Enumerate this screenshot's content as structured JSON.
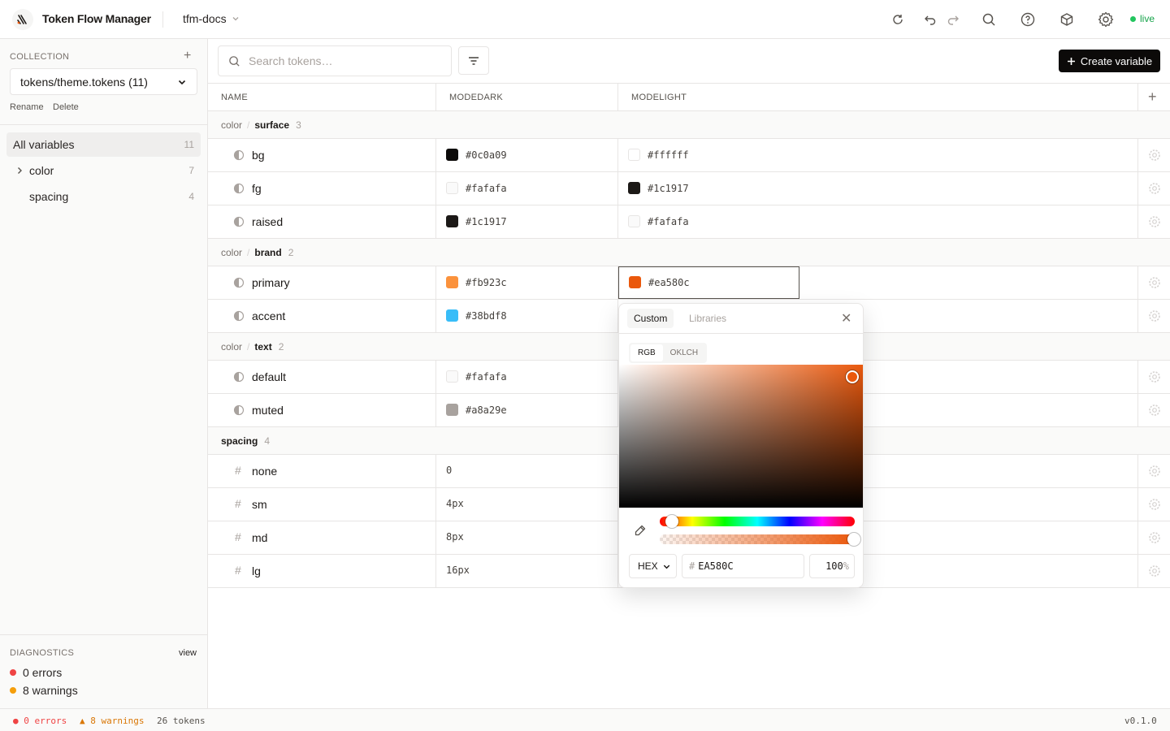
{
  "app": {
    "title": "Token Flow Manager",
    "project": "tfm-docs",
    "status": "live"
  },
  "sidebar": {
    "collection_label": "COLLECTION",
    "collection_value": "tokens/theme.tokens (11)",
    "rename": "Rename",
    "delete": "Delete",
    "nav": [
      {
        "label": "All variables",
        "count": "11"
      },
      {
        "label": "color",
        "count": "7"
      },
      {
        "label": "spacing",
        "count": "4"
      }
    ],
    "diagnostics": {
      "label": "DIAGNOSTICS",
      "view": "view",
      "errors": "0 errors",
      "warnings": "8 warnings"
    }
  },
  "toolbar": {
    "search_placeholder": "Search tokens…",
    "create": "Create variable"
  },
  "table": {
    "headers": [
      "NAME",
      "MODEDARK",
      "MODELIGHT"
    ],
    "groups": [
      {
        "prefix": "color",
        "name": "surface",
        "count": "3"
      },
      {
        "prefix": "color",
        "name": "brand",
        "count": "2"
      },
      {
        "prefix": "color",
        "name": "text",
        "count": "2"
      },
      {
        "prefix": "",
        "name": "spacing",
        "count": "4"
      }
    ],
    "rows": [
      {
        "name": "bg",
        "dark": "#0c0a09",
        "light": "#ffffff"
      },
      {
        "name": "fg",
        "dark": "#fafafa",
        "light": "#1c1917"
      },
      {
        "name": "raised",
        "dark": "#1c1917",
        "light": "#fafafa"
      },
      {
        "name": "primary",
        "dark": "#fb923c",
        "light": "#ea580c"
      },
      {
        "name": "accent",
        "dark": "#38bdf8",
        "light": ""
      },
      {
        "name": "default",
        "dark": "#fafafa",
        "light": ""
      },
      {
        "name": "muted",
        "dark": "#a8a29e",
        "light": ""
      },
      {
        "name": "none",
        "dark": "0",
        "light": ""
      },
      {
        "name": "sm",
        "dark": "4px",
        "light": ""
      },
      {
        "name": "md",
        "dark": "8px",
        "light": ""
      },
      {
        "name": "lg",
        "dark": "16px",
        "light": ""
      }
    ]
  },
  "picker": {
    "tab_custom": "Custom",
    "tab_libraries": "Libraries",
    "mode_rgb": "RGB",
    "mode_oklch": "OKLCH",
    "format": "HEX",
    "hex_prefix": "#",
    "hex": "EA580C",
    "alpha": "100",
    "alpha_unit": "%",
    "alpha_fraction": 1.0
  },
  "statusbar": {
    "errors": "● 0 errors",
    "warnings": "▲ 8 warnings",
    "tokens": "26 tokens",
    "version": "v0.1.0"
  },
  "colors": {
    "accent": "#ea580c",
    "primary_btn": "#0c0a09",
    "live": "#22c55e",
    "error": "#ef4444",
    "warning": "#f59e0b"
  }
}
